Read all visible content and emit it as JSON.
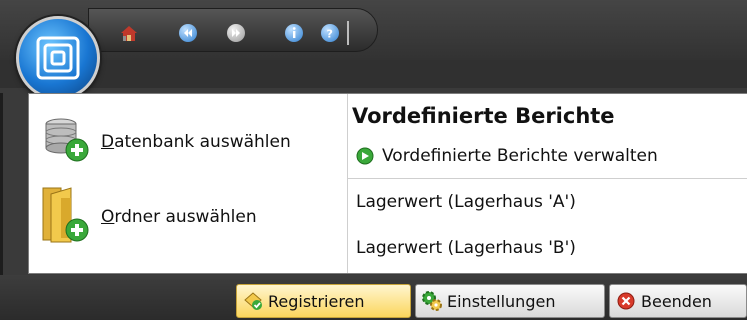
{
  "quick_access": {
    "icons": [
      "home-icon",
      "back-icon",
      "forward-icon",
      "info-icon",
      "help-icon"
    ]
  },
  "app_orb": {
    "icon": "app-logo-icon"
  },
  "left_actions": [
    {
      "underline": "D",
      "rest": "atenbank auswählen",
      "icon": "database-add-icon"
    },
    {
      "underline": "O",
      "rest": "rdner auswählen",
      "icon": "folder-add-icon"
    }
  ],
  "reports": {
    "title": "Vordefinierte Berichte",
    "manage_label": "Vordefinierte Berichte verwalten",
    "items": [
      "Lagerwert (Lagerhaus 'A')",
      "Lagerwert (Lagerhaus 'B')"
    ]
  },
  "bottom_buttons": [
    {
      "label": "Registrieren",
      "icon": "register-icon",
      "active": true
    },
    {
      "label": "Einstellungen",
      "icon": "settings-icon",
      "active": false
    },
    {
      "label": "Beenden",
      "icon": "exit-icon",
      "active": false
    }
  ],
  "colors": {
    "background": "#3a3a3a",
    "panel": "#ffffff",
    "active_button": "#fbd65d",
    "accent_green": "#3aa83a"
  }
}
